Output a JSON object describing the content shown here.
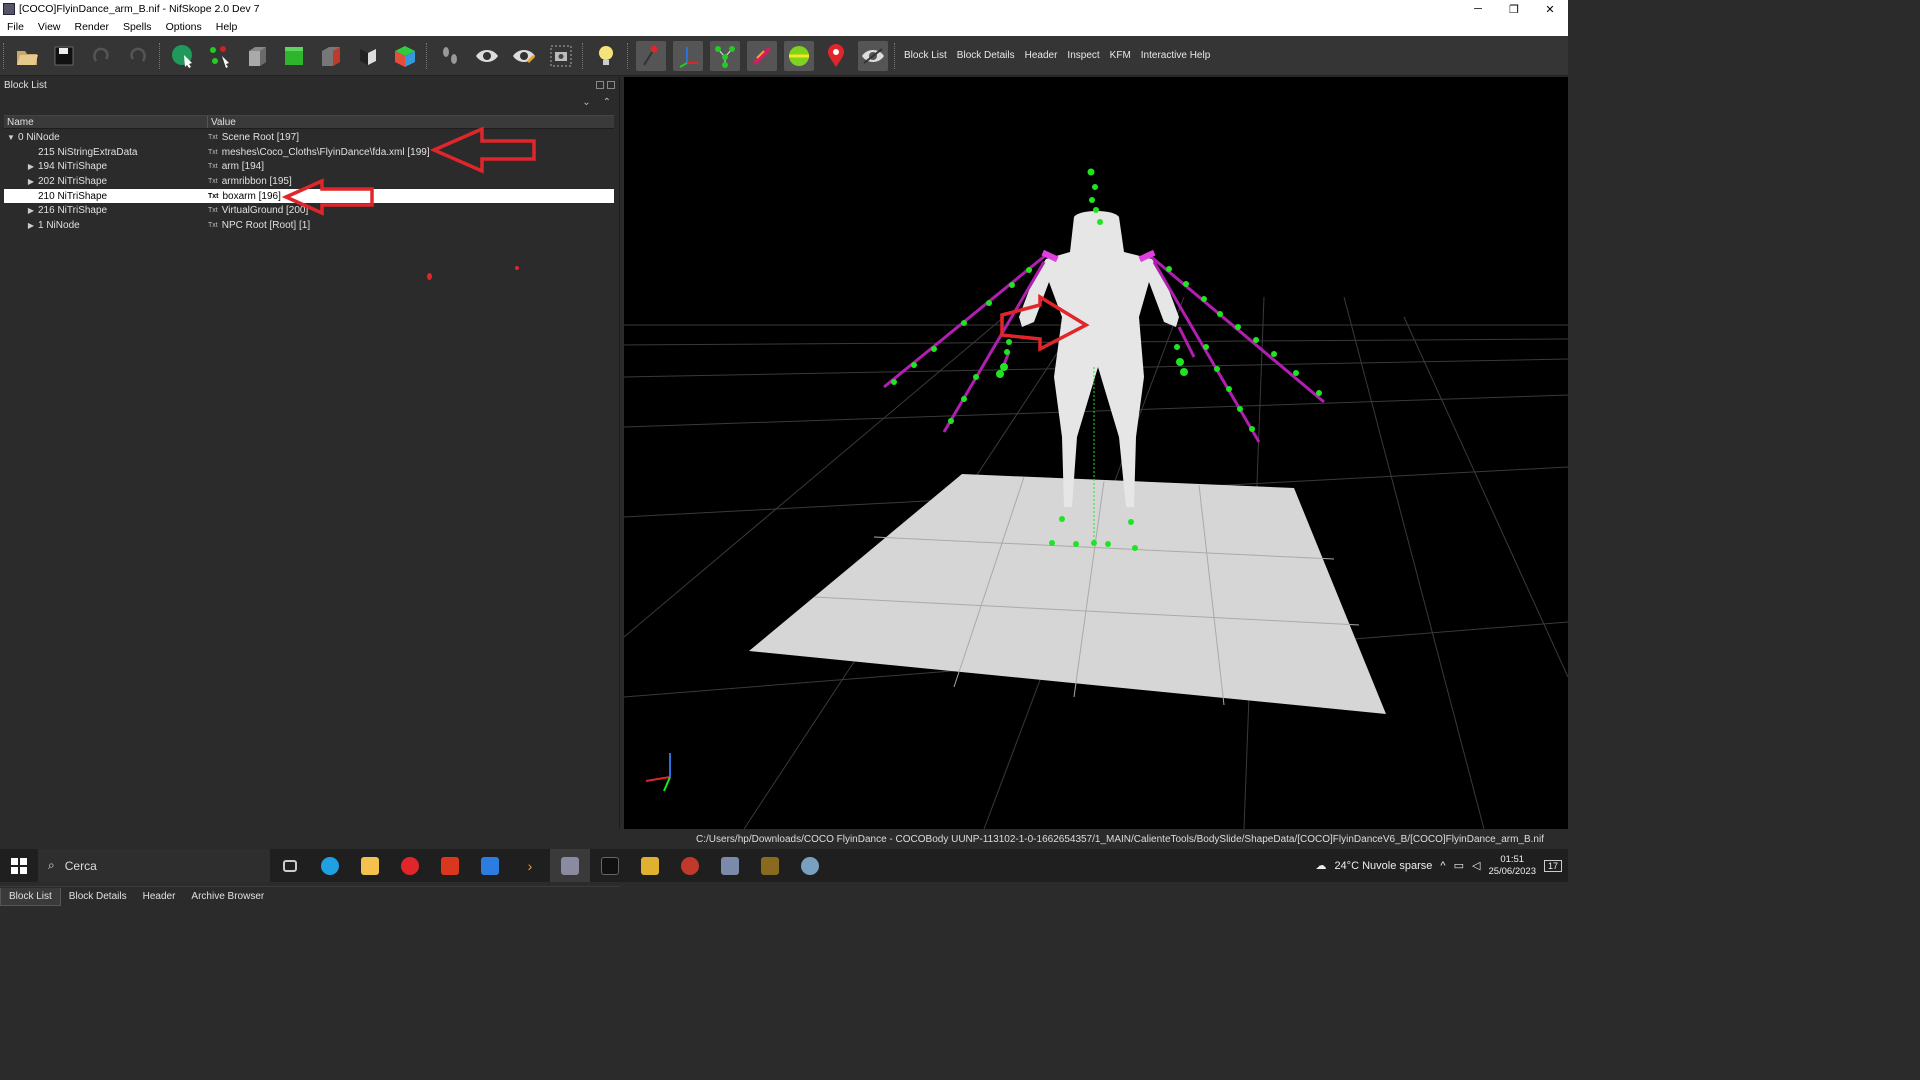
{
  "window": {
    "title": "[COCO]FlyinDance_arm_B.nif - NifSkope 2.0 Dev 7",
    "minimize": "─",
    "restore": "❐",
    "close": "✕"
  },
  "menu": [
    "File",
    "View",
    "Render",
    "Spells",
    "Options",
    "Help"
  ],
  "toolbar": {
    "links": [
      "Block List",
      "Block Details",
      "Header",
      "Inspect",
      "KFM",
      "Interactive Help"
    ]
  },
  "block_list": {
    "panel_title": "Block List",
    "columns": {
      "name": "Name",
      "value": "Value"
    },
    "collapse_all": "⌄",
    "expand_all": "⌃",
    "rows": [
      {
        "expander": "▼",
        "name": "0 NiNode",
        "type_icon": "Txt",
        "value": "Scene Root [197]"
      },
      {
        "expander": "",
        "name": "215 NiStringExtraData",
        "type_icon": "Txt",
        "value": "meshes\\Coco_Cloths\\FlyinDance\\fda.xml [199]"
      },
      {
        "expander": "▶",
        "name": "194 NiTriShape",
        "type_icon": "Txt",
        "value": "arm [194]"
      },
      {
        "expander": "▶",
        "name": "202 NiTriShape",
        "type_icon": "Txt",
        "value": "armribbon [195]"
      },
      {
        "expander": "",
        "name": "210 NiTriShape",
        "type_icon": "Txt",
        "value": "boxarm [196]"
      },
      {
        "expander": "▶",
        "name": "216 NiTriShape",
        "type_icon": "Txt",
        "value": "VirtualGround [200]"
      },
      {
        "expander": "▶",
        "name": "1 NiNode",
        "type_icon": "Txt",
        "value": "NPC Root [Root] [1]"
      }
    ]
  },
  "bottom_tabs": [
    "Block List",
    "Block Details",
    "Header",
    "Archive Browser"
  ],
  "status_path": "C:/Users/hp/Downloads/COCO FlyinDance - COCOBody UUNP-113102-1-0-1662654357/1_MAIN/CalienteTools/BodySlide/ShapeData/[COCO]FlyinDanceV6_B/[COCO]FlyinDance_arm_B.nif",
  "taskbar": {
    "search_placeholder": "Cerca",
    "weather": "24°C  Nuvole sparse",
    "time": "01:51",
    "date": "25/06/2023",
    "notification_count": "17"
  },
  "colors": {
    "accent_red": "#e0262b",
    "bone_green": "#1ee61e",
    "ribbon_magenta": "#b01fb0"
  }
}
